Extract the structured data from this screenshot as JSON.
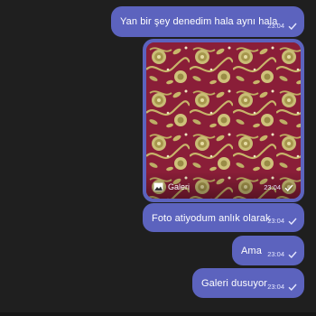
{
  "messages": [
    {
      "text": "Yan bir şey denedim hala aynı hala",
      "time": "23:04",
      "status": "sent"
    },
    {
      "type": "image",
      "caption": "Galeri",
      "time": "23:04",
      "status": "sent"
    },
    {
      "text": "Foto atiyodum anlık olarak",
      "time": "23:04",
      "status": "sent"
    },
    {
      "text": "Ama",
      "time": "23:04",
      "status": "sent"
    },
    {
      "text": "Galeri dusuyor",
      "time": "23:04",
      "status": "sent"
    }
  ],
  "icons": {
    "status": "check-icon",
    "gallery": "gallery-icon"
  },
  "colors": {
    "background": "#1f1f1f",
    "bubble": "#5c63be",
    "carpet_red": "#8a1e38",
    "carpet_gold": "#c8b56a"
  }
}
